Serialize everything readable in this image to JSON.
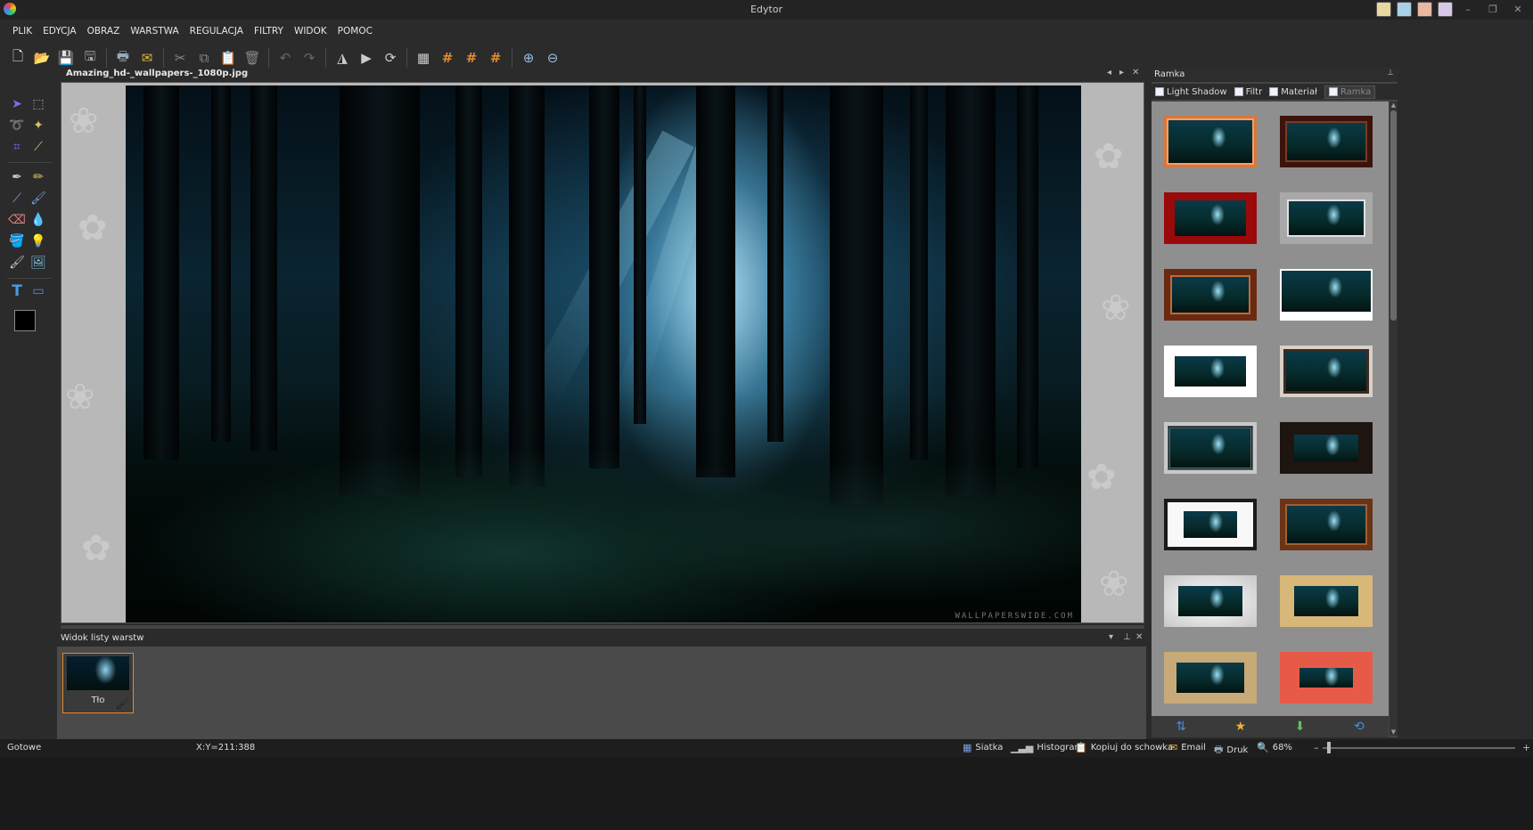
{
  "window": {
    "title": "Edytor"
  },
  "menu": [
    "PLIK",
    "EDYCJA",
    "OBRAZ",
    "WARSTWA",
    "REGULACJA",
    "FILTRY",
    "WIDOK",
    "POMOC"
  ],
  "document": {
    "tab_label": "Amazing_hd-_wallpapers-_1080p.jpg",
    "watermark": "WALLPAPERSWIDE.COM"
  },
  "layers_panel": {
    "title": "Widok listy warstw",
    "layers": [
      {
        "name": "Tło"
      }
    ]
  },
  "right_panel": {
    "title": "Ramka",
    "tabs": [
      "Light Shadow",
      "Filtr",
      "Materiał",
      "Ramka"
    ],
    "active_tab": "Ramka",
    "frame_count": 14
  },
  "status": {
    "state": "Gotowe",
    "coords": "X:Y=211:388",
    "grid_label": "Siatka",
    "histogram_label": "Histogram",
    "copy_label": "Kopiuj do schowka",
    "email_label": "Email",
    "print_label": "Druk",
    "zoom": "68%"
  },
  "colors": {
    "accent": "#e08a2e",
    "foreground": "#000000",
    "background": "#ffffff"
  }
}
